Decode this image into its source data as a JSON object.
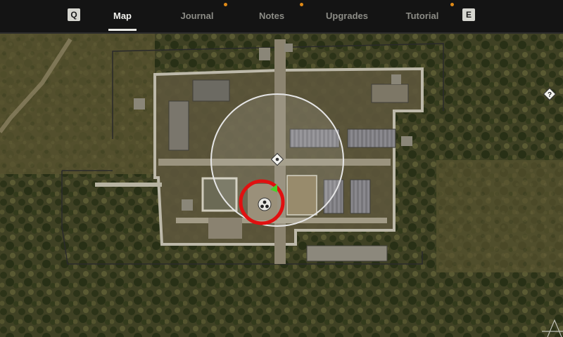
{
  "nav": {
    "left_key": "Q",
    "right_key": "E",
    "tabs": [
      {
        "label": "Map",
        "active": true
      },
      {
        "label": "Journal",
        "active": false,
        "notification": true
      },
      {
        "label": "Notes",
        "active": false,
        "notification": true
      },
      {
        "label": "Upgrades",
        "active": false
      },
      {
        "label": "Tutorial",
        "active": false,
        "notification": true
      }
    ],
    "notification_color": "#e08a16"
  },
  "map": {
    "terrain_color": "#4a4a2a",
    "base_color": "#6f6550",
    "marker_circle_color": "#e01010",
    "icons": [
      "player-location-icon",
      "waypoint-diamond-icon",
      "unknown-location-icon",
      "player-arrow-icon"
    ]
  }
}
